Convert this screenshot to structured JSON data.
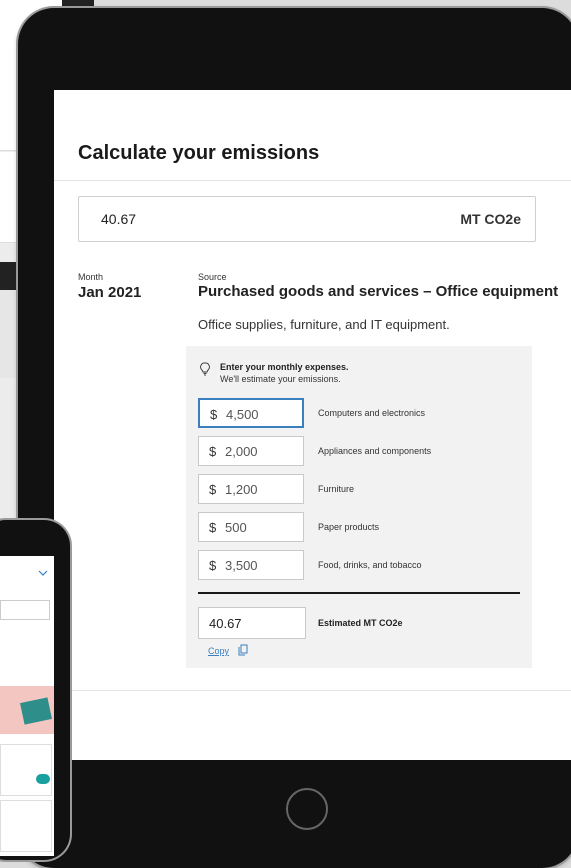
{
  "calculator": {
    "title": "Calculate your emissions",
    "result_value": "40.67",
    "result_unit": "MT CO2e",
    "month_label": "Month",
    "month_value": "Jan 2021",
    "source_label": "Source",
    "source_value": "Purchased goods and services – Office equipment",
    "description": "Office supplies, furniture, and IT equipment.",
    "hint_title": "Enter your monthly expenses.",
    "hint_sub": "We'll estimate your emissions.",
    "currency_symbol": "$",
    "expenses": [
      {
        "amount": "4,500",
        "label": "Computers and electronics"
      },
      {
        "amount": "2,000",
        "label": "Appliances and components"
      },
      {
        "amount": "1,200",
        "label": "Furniture"
      },
      {
        "amount": "500",
        "label": "Paper products"
      },
      {
        "amount": "3,500",
        "label": "Food, drinks, and tobacco"
      }
    ],
    "estimate_value": "40.67",
    "estimate_label": "Estimated MT CO2e",
    "copy_label": "Copy"
  },
  "icons": {
    "hint": "lightbulb-icon",
    "copy": "copy-icon",
    "dropdown": "chevron-down-icon"
  },
  "colors": {
    "accent": "#3b7fbf",
    "panel_bg": "#f2f2f2",
    "device_frame": "#111111"
  }
}
